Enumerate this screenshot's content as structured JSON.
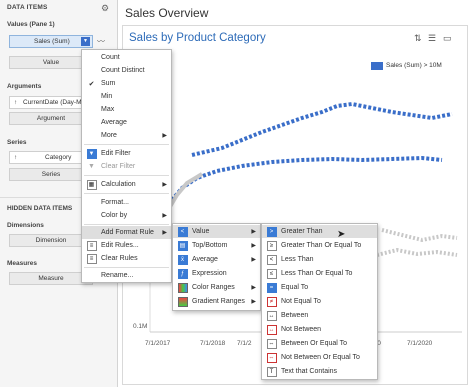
{
  "left_pane": {
    "title": "DATA ITEMS",
    "values_section": "Values (Pane 1)",
    "values_pill": "Sales (Sum)",
    "value_button": "Value",
    "arguments_section": "Arguments",
    "argument_pill": "CurrentDate (Day-M",
    "argument_button": "Argument",
    "series_section": "Series",
    "series_pill": "Category",
    "series_button": "Series",
    "hidden_title": "HIDDEN DATA ITEMS",
    "dimensions_section": "Dimensions",
    "dimension_button": "Dimension",
    "measures_section": "Measures",
    "measure_button": "Measure"
  },
  "dashboard": {
    "title": "Sales Overview",
    "chart_title": "Sales by Product Category",
    "legend_label": "Sales (Sum) > 10M",
    "y_axis_bottom": "0.1M",
    "x_ticks": [
      "7/1/2017",
      "7/1/2018",
      "7/1/2",
      "020",
      "7/1/2020"
    ]
  },
  "menu1": {
    "items": [
      "Count",
      "Count Distinct",
      "Sum",
      "Min",
      "Max",
      "Average",
      "More",
      "Edit Filter",
      "Clear Filter",
      "Calculation",
      "Format...",
      "Color by",
      "Add Format Rule",
      "Edit Rules...",
      "Clear Rules",
      "Rename..."
    ]
  },
  "menu2": {
    "items": [
      "Value",
      "Top/Bottom",
      "Average",
      "Expression",
      "Color Ranges",
      "Gradient Ranges"
    ]
  },
  "menu3": {
    "items": [
      "Greater Than",
      "Greater Than Or Equal To",
      "Less Than",
      "Less Than Or Equal To",
      "Equal To",
      "Not Equal To",
      "Between",
      "Not Between",
      "Between Or Equal To",
      "Not Between Or Equal To",
      "Text that Contains"
    ]
  },
  "colors": {
    "accent": "#2d6bb8",
    "series_blue": "#3a6ec9",
    "series_gray": "#c8c8c8"
  }
}
